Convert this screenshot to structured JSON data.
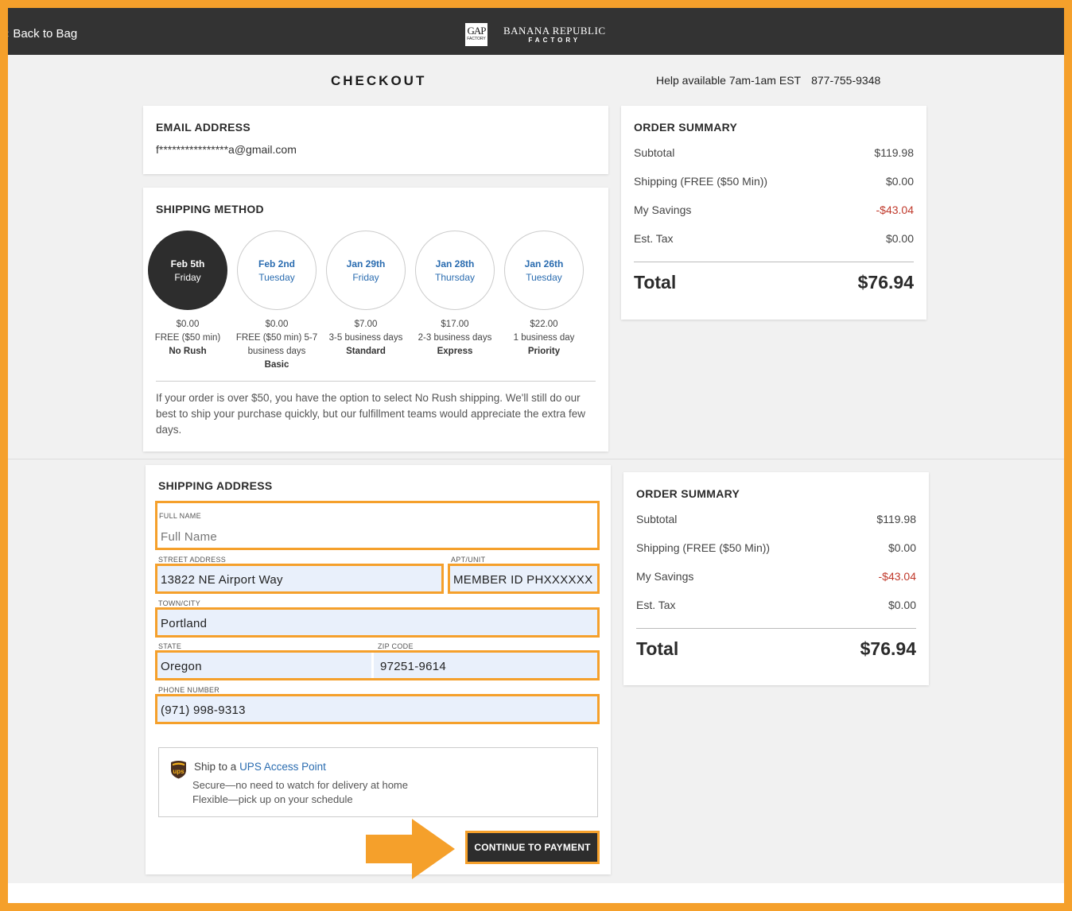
{
  "header": {
    "back_label": "Back to Bag",
    "gap_logo_text": "GAP",
    "gap_logo_sub": "FACTORY",
    "br_logo_line1": "BANANA REPUBLIC",
    "br_logo_line2": "FACTORY"
  },
  "page": {
    "title": "CHECKOUT",
    "help_text": "Help available 7am-1am EST",
    "help_phone": "877-755-9348"
  },
  "email": {
    "heading": "EMAIL ADDRESS",
    "value": "f****************a@gmail.com"
  },
  "shipping_method": {
    "heading": "SHIPPING METHOD",
    "options": [
      {
        "date": "Feb 5th",
        "day": "Friday",
        "price": "$0.00",
        "desc": "FREE ($50 min)",
        "name": "No Rush",
        "selected": true
      },
      {
        "date": "Feb 2nd",
        "day": "Tuesday",
        "price": "$0.00",
        "desc": "FREE ($50 min) 5-7 business days",
        "name": "Basic",
        "selected": false
      },
      {
        "date": "Jan 29th",
        "day": "Friday",
        "price": "$7.00",
        "desc": "3-5 business days",
        "name": "Standard",
        "selected": false
      },
      {
        "date": "Jan 28th",
        "day": "Thursday",
        "price": "$17.00",
        "desc": "2-3 business days",
        "name": "Express",
        "selected": false
      },
      {
        "date": "Jan 26th",
        "day": "Tuesday",
        "price": "$22.00",
        "desc": "1 business day",
        "name": "Priority",
        "selected": false
      }
    ],
    "note": "If your order is over $50, you have the option to select No Rush shipping. We'll still do our best to ship your purchase quickly, but our fulfillment teams would appreciate the extra few days."
  },
  "order_summary": {
    "heading": "ORDER SUMMARY",
    "subtotal_label": "Subtotal",
    "subtotal_value": "$119.98",
    "shipping_label": "Shipping (FREE ($50 Min))",
    "shipping_value": "$0.00",
    "savings_label": "My Savings",
    "savings_value": "-$43.04",
    "tax_label": "Est. Tax",
    "tax_value": "$0.00",
    "total_label": "Total",
    "total_value": "$76.94"
  },
  "shipping_address": {
    "heading": "SHIPPING ADDRESS",
    "full_name_label": "FULL NAME",
    "full_name_placeholder": "Full Name",
    "street_label": "STREET ADDRESS",
    "street_value": "13822 NE Airport Way",
    "apt_label": "APT/UNIT",
    "apt_value": "MEMBER ID PHXXXXXX",
    "city_label": "TOWN/CITY",
    "city_value": "Portland",
    "state_label": "STATE",
    "state_value": "Oregon",
    "zip_label": "ZIP CODE",
    "zip_value": "97251-9614",
    "phone_label": "PHONE NUMBER",
    "phone_value": "(971) 998-9313"
  },
  "ups": {
    "prefix": "Ship to a",
    "link": "UPS Access Point",
    "line1": "Secure—no need to watch for delivery at home",
    "line2": "Flexible—pick up on your schedule"
  },
  "continue_label": "CONTINUE TO PAYMENT",
  "colors": {
    "highlight": "#f5a02b",
    "dark": "#333333",
    "link": "#2a6cb0",
    "negative": "#c0392b"
  }
}
